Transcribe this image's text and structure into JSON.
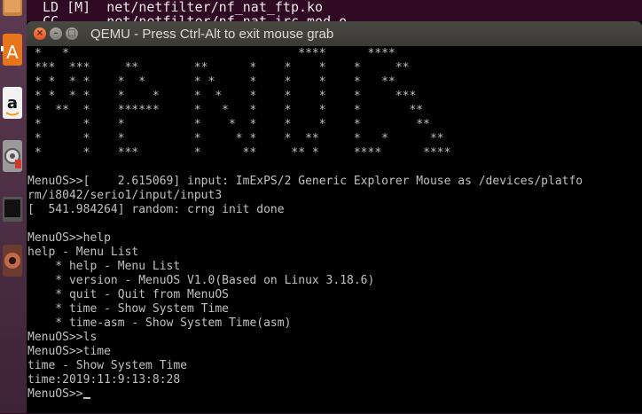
{
  "background_terminal": {
    "lines": [
      "LD [M]  net/netfilter/nf_nat_ftp.ko",
      "CC      net/netfilter/nf_nat_irc_mod.o"
    ]
  },
  "launcher": {
    "icons": [
      "files-icon",
      "software-center-icon",
      "amazon-icon",
      "system-settings-icon",
      "workspace-switcher-icon",
      "app-icon"
    ]
  },
  "window": {
    "title": "QEMU - Press Ctrl-Alt to exit mouse grab",
    "close_symbol": "×",
    "minimize_symbol": "–",
    "maximize_symbol": "□"
  },
  "terminal": {
    "banner": [
      " *   *                                 ****      ****",
      " ***  ***     **        **      *    *    *    *     **",
      " * *  * *    *  *       * *     *    *    *    *   **",
      " * *  * *    *    *     *  *    *    *    *    *     ***",
      " *  **  *    ******     *   *   *    *    *    *       **",
      " *      *    *          *    *  *    *    *    *        **",
      " *      *    *          *     * *    *  **     *   *      **",
      " *      *    ***        *      **     ** *     ****      ****"
    ],
    "log": [
      "",
      "MenuOS>>[    2.615069] input: ImExPS/2 Generic Explorer Mouse as /devices/platfo",
      "rm/i8042/serio1/input/input3",
      "[  541.984264] random: crng init done",
      "",
      "MenuOS>>help",
      "help - Menu List",
      "    * help - Menu List",
      "    * version - MenuOS V1.0(Based on Linux 3.18.6)",
      "    * quit - Quit from MenuOS",
      "    * time - Show System Time",
      "    * time-asm - Show System Time(asm)",
      "MenuOS>>ls",
      "MenuOS>>time",
      "time - Show System Time",
      "time:2019:11:9:13:8:28"
    ],
    "prompt": "MenuOS>>"
  },
  "colors": {
    "terminal_bg": "#000000",
    "terminal_fg": "#c0c0c0",
    "titlebar": "#3c3b37",
    "ubuntu_bg": "#300a24",
    "close_button": "#e95420"
  }
}
